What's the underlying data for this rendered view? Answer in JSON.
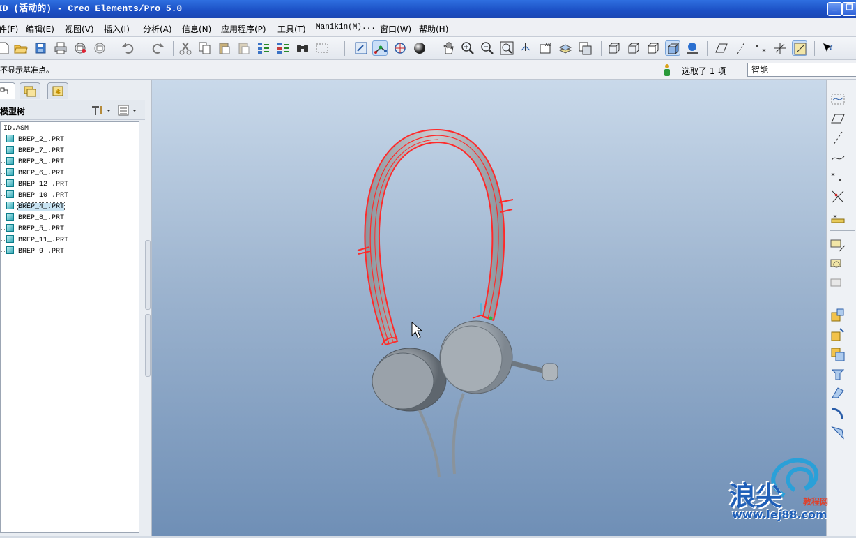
{
  "window": {
    "title": "ID (活动的) - Creo Elements/Pro 5.0",
    "controls": [
      "minimize",
      "restore"
    ]
  },
  "menu": [
    {
      "id": "file",
      "label": "件(F)"
    },
    {
      "id": "edit",
      "label": "编辑(E)"
    },
    {
      "id": "view",
      "label": "视图(V)"
    },
    {
      "id": "insert",
      "label": "插入(I)"
    },
    {
      "id": "analysis",
      "label": "分析(A)"
    },
    {
      "id": "info",
      "label": "信息(N)"
    },
    {
      "id": "apps",
      "label": "应用程序(P)"
    },
    {
      "id": "tools",
      "label": "工具(T)"
    },
    {
      "id": "manikin",
      "label": "Manikin(M)..."
    },
    {
      "id": "window",
      "label": "窗口(W)"
    },
    {
      "id": "help",
      "label": "帮助(H)"
    }
  ],
  "toolbar": {
    "icons": [
      "new-file-icon",
      "open-folder-icon",
      "save-icon",
      "print-icon",
      "send-mail-icon",
      "mail-attach-icon",
      "undo-icon",
      "redo-icon",
      "cut-icon",
      "copy-icon",
      "paste-icon",
      "paste-special-icon",
      "regenerate-icon",
      "regen-manager-icon",
      "find-binoculars-icon",
      "select-box-icon",
      "repaint-icon",
      "spin-center-icon",
      "orient-icon",
      "shade-sphere-icon",
      "pan-hand-icon",
      "zoom-in-icon",
      "zoom-out-icon",
      "refit-icon",
      "reorient-icon",
      "saved-views-icon",
      "layers-icon",
      "view-manager-icon",
      "wireframe-icon",
      "hidden-line-icon",
      "no-hidden-icon",
      "shading-icon",
      "model-tree-display-icon",
      "datum-planes-icon",
      "datum-axes-icon",
      "datum-points-icon",
      "coord-systems-icon",
      "annotations-toggle-icon",
      "whats-this-icon"
    ]
  },
  "status": {
    "message": "不显示基准点。",
    "selection": "选取了 1 项",
    "filter_value": "智能"
  },
  "left_panel": {
    "tabs": [
      "model-tree-tab",
      "folder-browser-tab",
      "favorites-tab"
    ],
    "header": "模型树",
    "root": "ID.ASM",
    "items": [
      "BREP_2_.PRT",
      "BREP_7_.PRT",
      "BREP_3_.PRT",
      "BREP_6_.PRT",
      "BREP_12_.PRT",
      "BREP_10_.PRT",
      "BREP_4_.PRT",
      "BREP_8_.PRT",
      "BREP_5_.PRT",
      "BREP_11_.PRT",
      "BREP_9_.PRT"
    ],
    "selected_item": "BREP_4_.PRT"
  },
  "right_toolbar": {
    "icons": [
      "sketch-icon",
      "datum-plane-icon",
      "datum-axis-icon",
      "datum-curve-icon",
      "datum-point-icon",
      "offset-point-icon",
      "field-point-icon",
      "csys-icon",
      "analysis-feature-icon",
      "reference-feature-icon",
      "assemble-icon",
      "create-component-icon",
      "repeat-icon",
      "pattern-icon",
      "round-icon",
      "chamfer-icon",
      "draft-icon"
    ]
  },
  "watermark": {
    "brand": "浪尖",
    "tag": "教程网",
    "url": "www.lej88.com"
  },
  "colors": {
    "selection_highlight": "#ff2a2a",
    "headphone_body": "#a9b1b8",
    "viewport_top": "#c9d9ea",
    "viewport_bottom": "#6f8fb6",
    "titlebar": "#1b4fc4"
  }
}
